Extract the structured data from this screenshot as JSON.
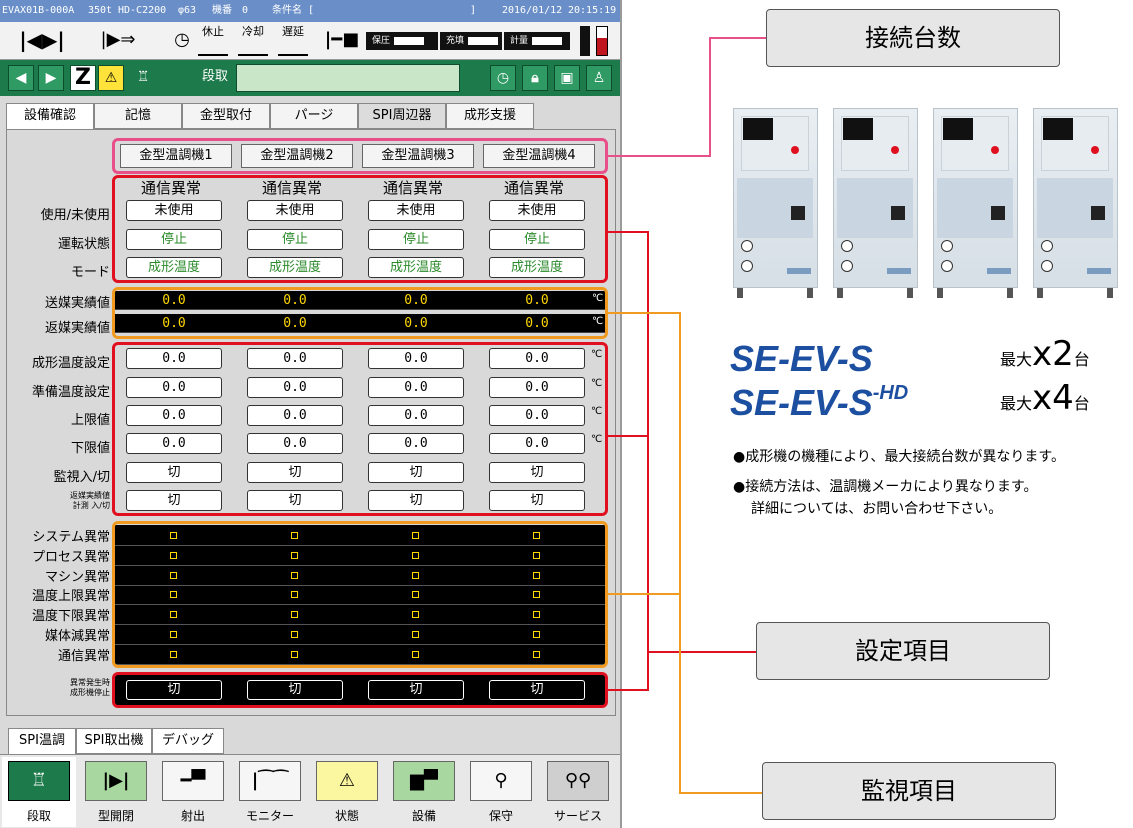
{
  "statusbar": {
    "model": "EVAX01B-000A",
    "tonnage": "350t",
    "machine": "HD-C2200",
    "screw": "φ63",
    "machine_no_label": "機番",
    "machine_no": "0",
    "condition_label": "条件名 [",
    "condition_end": "]",
    "date": "2016/01/12",
    "time": "20:15:19"
  },
  "iconbar": {
    "items": [
      "休止",
      "冷却",
      "遅延"
    ],
    "gauges": [
      "保圧",
      "充填",
      "計量"
    ]
  },
  "greenbar": {
    "mode_label": "段取"
  },
  "tabs": [
    "設備確認",
    "記憶",
    "金型取付",
    "パージ",
    "SPI周辺器",
    "成形支援"
  ],
  "units": [
    "金型温調機1",
    "金型温調機2",
    "金型温調機3",
    "金型温調機4"
  ],
  "comm_status": [
    "通信異常",
    "通信異常",
    "通信異常",
    "通信異常"
  ],
  "rows": {
    "use": {
      "label": "使用/未使用",
      "values": [
        "未使用",
        "未使用",
        "未使用",
        "未使用"
      ]
    },
    "run": {
      "label": "運転状態",
      "values": [
        "停止",
        "停止",
        "停止",
        "停止"
      ]
    },
    "mode": {
      "label": "モード",
      "values": [
        "成形温度",
        "成形温度",
        "成形温度",
        "成形温度"
      ]
    },
    "send": {
      "label": "送媒実績値",
      "values": [
        "0.0",
        "0.0",
        "0.0",
        "0.0"
      ],
      "unit": "℃"
    },
    "return": {
      "label": "返媒実績値",
      "values": [
        "0.0",
        "0.0",
        "0.0",
        "0.0"
      ],
      "unit": "℃"
    },
    "molding_set": {
      "label": "成形温度設定",
      "values": [
        "0.0",
        "0.0",
        "0.0",
        "0.0"
      ],
      "unit": "℃"
    },
    "prep_set": {
      "label": "準備温度設定",
      "values": [
        "0.0",
        "0.0",
        "0.0",
        "0.0"
      ],
      "unit": "℃"
    },
    "upper": {
      "label": "上限値",
      "values": [
        "0.0",
        "0.0",
        "0.0",
        "0.0"
      ],
      "unit": "℃"
    },
    "lower": {
      "label": "下限値",
      "values": [
        "0.0",
        "0.0",
        "0.0",
        "0.0"
      ],
      "unit": "℃"
    },
    "monitor": {
      "label": "監視入/切",
      "values": [
        "切",
        "切",
        "切",
        "切"
      ]
    },
    "return_measure": {
      "label1": "返媒実績値",
      "label2": "計測 入/切",
      "values": [
        "切",
        "切",
        "切",
        "切"
      ]
    }
  },
  "alarms": [
    "システム異常",
    "プロセス異常",
    "マシン異常",
    "温度上限異常",
    "温度下限異常",
    "媒体減異常",
    "通信異常"
  ],
  "stop_on_error": {
    "label1": "異常発生時",
    "label2": "成形機停止",
    "values": [
      "切",
      "切",
      "切",
      "切"
    ]
  },
  "bottom_tabs": [
    "SPI温調",
    "SPI取出機",
    "デバッグ"
  ],
  "nav": [
    "段取",
    "型開閉",
    "射出",
    "モニター",
    "状態",
    "設備",
    "保守",
    "サービス"
  ],
  "callouts": {
    "connected": "接続台数",
    "settings": "設定項目",
    "monitoring": "監視項目"
  },
  "models": [
    {
      "name": "SE-EV-S",
      "suffix": "",
      "max_prefix": "最大",
      "count": "x2",
      "unit": "台"
    },
    {
      "name": "SE-EV-S",
      "suffix": "-HD",
      "max_prefix": "最大",
      "count": "x4",
      "unit": "台"
    }
  ],
  "notes": [
    "●成形機の機種により、最大接続台数が異なります。",
    "●接続方法は、温調機メーカにより異なります。",
    "詳細については、お問い合わせ下さい。"
  ],
  "colors": {
    "statusbar": "#6a8fc8",
    "greenbar": "#1d7a4a",
    "settings_outline": "#e01020",
    "monitoring_outline": "#f09a20",
    "units_outline": "#e8508a"
  }
}
